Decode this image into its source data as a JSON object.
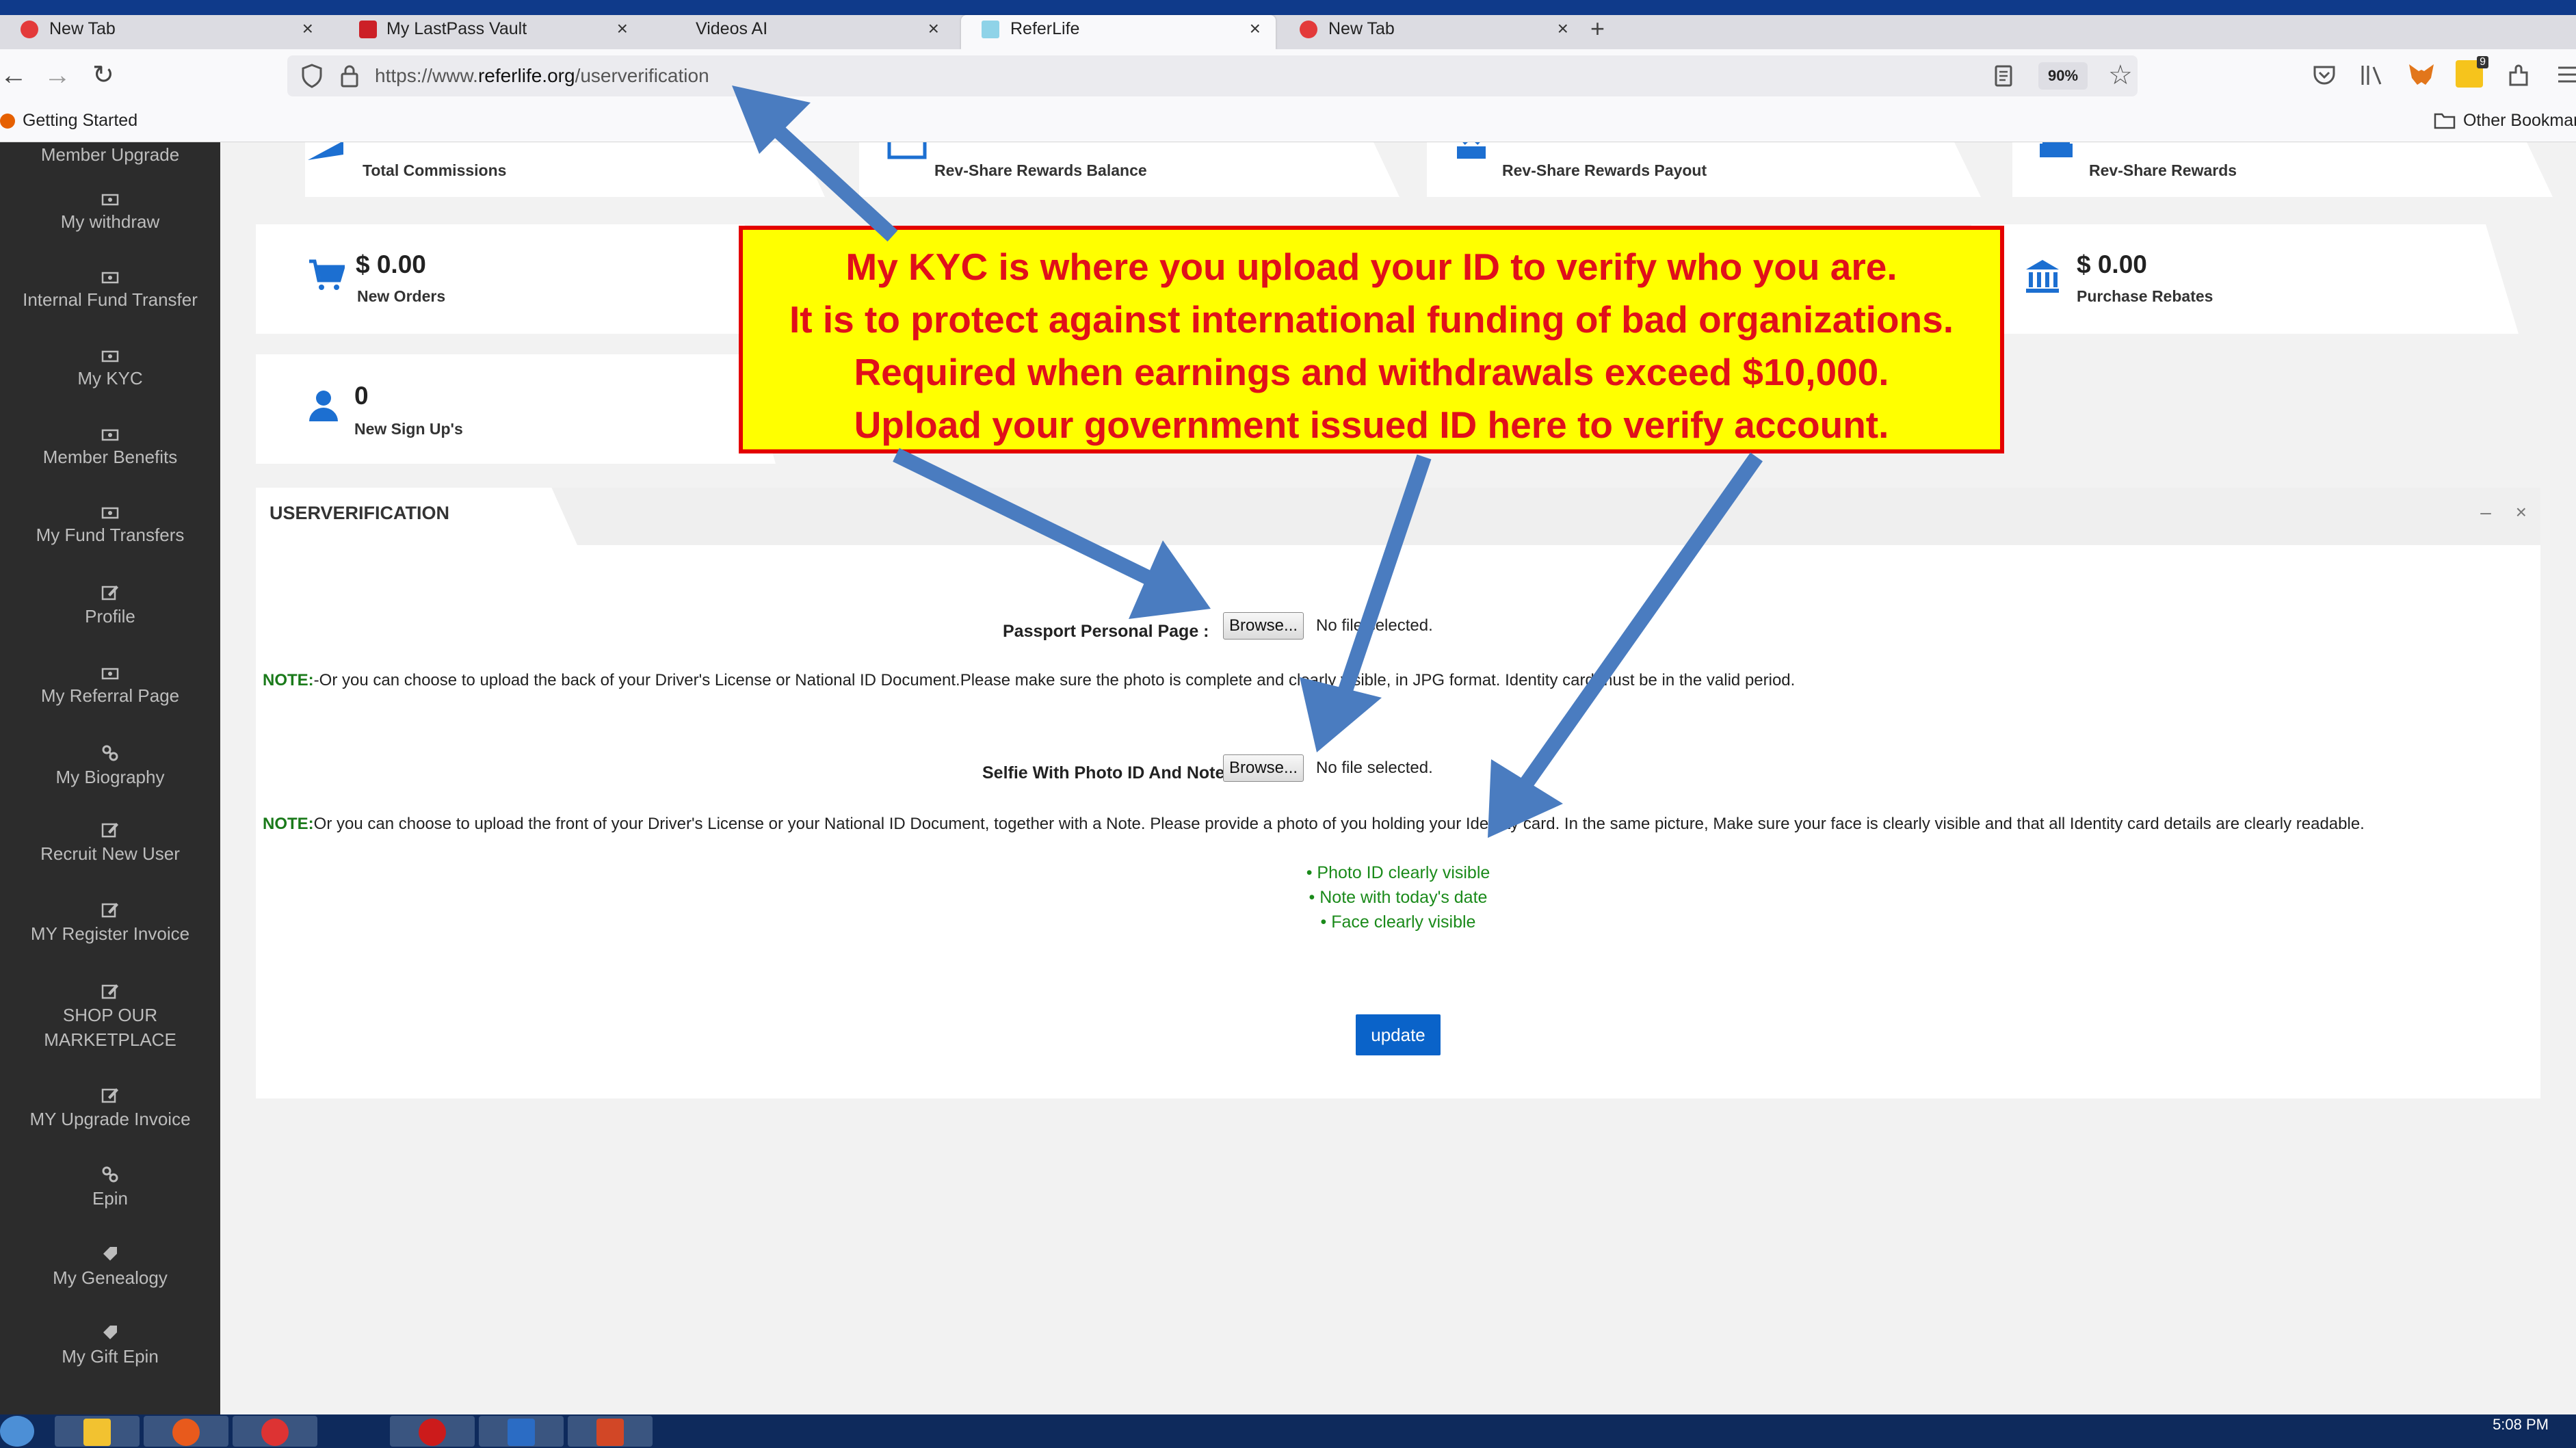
{
  "browser": {
    "tabs": [
      {
        "title": "New Tab",
        "icon": "firefox-icon",
        "active": false
      },
      {
        "title": "My LastPass Vault",
        "icon": "lastpass-icon",
        "active": false
      },
      {
        "title": "Videos AI",
        "icon": "",
        "active": false
      },
      {
        "title": "ReferLife",
        "icon": "referlife-icon",
        "active": true
      },
      {
        "title": "New Tab",
        "icon": "firefox-icon",
        "active": false
      }
    ],
    "new_tab": "+",
    "url_prefix": "https://www.",
    "url_domain": "referlife.org",
    "url_path": "/userverification",
    "zoom": "90%",
    "notification_count": "9",
    "bookmarks": {
      "getting_started": "Getting Started",
      "other_bookmarks": "Other Bookmarks"
    }
  },
  "sidebar": {
    "items": [
      {
        "label": "Member Upgrade",
        "icon": "money-icon"
      },
      {
        "label": "My withdraw",
        "icon": "money-icon"
      },
      {
        "label": "Internal Fund Transfer",
        "icon": "money-icon"
      },
      {
        "label": "My KYC",
        "icon": "money-icon"
      },
      {
        "label": "Member Benefits",
        "icon": "money-icon"
      },
      {
        "label": "My Fund Transfers",
        "icon": "money-icon"
      },
      {
        "label": "Profile",
        "icon": "edit-icon"
      },
      {
        "label": "My Referral Page",
        "icon": "money-icon"
      },
      {
        "label": "My Biography",
        "icon": "link-icon"
      },
      {
        "label": "Recruit New User",
        "icon": "edit-icon"
      },
      {
        "label": "MY Register Invoice",
        "icon": "edit-icon"
      },
      {
        "label": "SHOP OUR",
        "label2": "MARKETPLACE",
        "icon": "edit-icon"
      },
      {
        "label": "MY Upgrade Invoice",
        "icon": "edit-icon"
      },
      {
        "label": "Epin",
        "icon": "link-icon"
      },
      {
        "label": "My Genealogy",
        "icon": "tag-icon"
      },
      {
        "label": "My Gift Epin",
        "icon": "tag-icon"
      }
    ]
  },
  "stats": {
    "total_commissions": "Total Commissions",
    "rev_share_rewards_balance": "Rev-Share Rewards Balance",
    "rev_share_rewards_payout": "Rev-Share Rewards Payout",
    "rev_share_rewards": "Rev-Share Rewards",
    "new_orders_value": "$ 0.00",
    "new_orders_label": "New Orders",
    "purchase_rebates_value": "$ 0.00",
    "purchase_rebates_label": "Purchase Rebates",
    "sign_ups_value": "0",
    "sign_ups_label": "New Sign Up's"
  },
  "panel": {
    "title": "USERVERIFICATION",
    "minimize": "–",
    "close": "×",
    "passport_label": "Passport Personal Page :",
    "browse_label": "Browse...",
    "no_file": "No file selected.",
    "note1_key": "NOTE:",
    "note1_text": "-Or you can choose to upload the back of your Driver's License or National ID Document.Please make sure the photo is complete and clearly visible, in JPG format. Identity card must be in the valid period.",
    "selfie_label": "Selfie With Photo ID And Note :",
    "note2_key": "NOTE:",
    "note2_text": "Or you can choose to upload the front of your Driver's License or your National ID Document, together with a Note. Please provide a photo of you holding your Identity card. In the same picture, Make sure your face is clearly visible and that all Identity card details are clearly readable.",
    "requirements": [
      "Photo ID clearly visible",
      "Note with today's date",
      "Face clearly visible"
    ],
    "update_label": "update"
  },
  "callout": {
    "lines": [
      "My KYC is where you upload your ID to verify who you are.",
      "It is to protect against international funding of bad organizations.",
      "Required when earnings and withdrawals exceed $10,000.",
      "Upload your government issued ID here to verify account."
    ]
  },
  "taskbar": {
    "time": "5:08 PM"
  },
  "colors": {
    "callout_bg": "#ffff00",
    "callout_text": "#e0101a",
    "arrow": "#4a7cc0",
    "sidebar_bg": "#2c2c2c",
    "update_button": "#0a63c9",
    "note_green": "#1a7a1a"
  }
}
